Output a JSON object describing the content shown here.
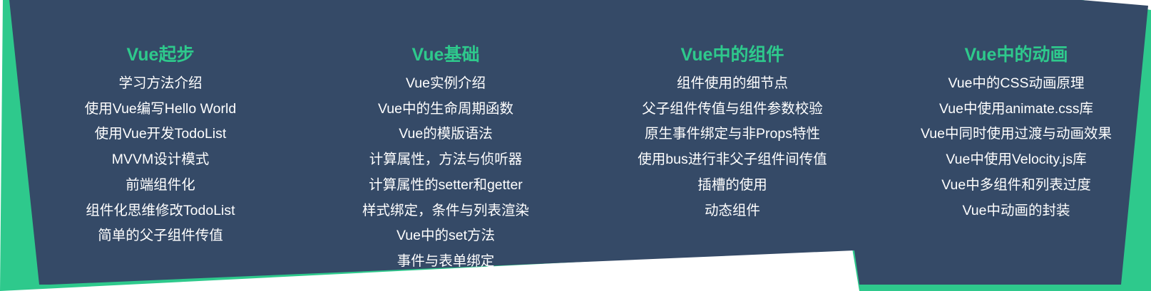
{
  "colors": {
    "background_panel": "#354a67",
    "accent_border": "#2ec98c",
    "title_text": "#2ec98c",
    "item_text": "#ffffff"
  },
  "columns": [
    {
      "title": "Vue起步",
      "items": [
        "学习方法介绍",
        "使用Vue编写Hello World",
        "使用Vue开发TodoList",
        "MVVM设计模式",
        "前端组件化",
        "组件化思维修改TodoList",
        "简单的父子组件传值"
      ]
    },
    {
      "title": "Vue基础",
      "items": [
        "Vue实例介绍",
        "Vue中的生命周期函数",
        "Vue的模版语法",
        "计算属性，方法与侦听器",
        "计算属性的setter和getter",
        "样式绑定，条件与列表渲染",
        "Vue中的set方法",
        "事件与表单绑定"
      ]
    },
    {
      "title": "Vue中的组件",
      "items": [
        "组件使用的细节点",
        "父子组件传值与组件参数校验",
        "原生事件绑定与非Props特性",
        "使用bus进行非父子组件间传值",
        "插槽的使用",
        "动态组件"
      ]
    },
    {
      "title": "Vue中的动画",
      "items": [
        "Vue中的CSS动画原理",
        "Vue中使用animate.css库",
        "Vue中同时使用过渡与动画效果",
        "Vue中使用Velocity.js库",
        "Vue中多组件和列表过度",
        "Vue中动画的封装"
      ]
    }
  ]
}
